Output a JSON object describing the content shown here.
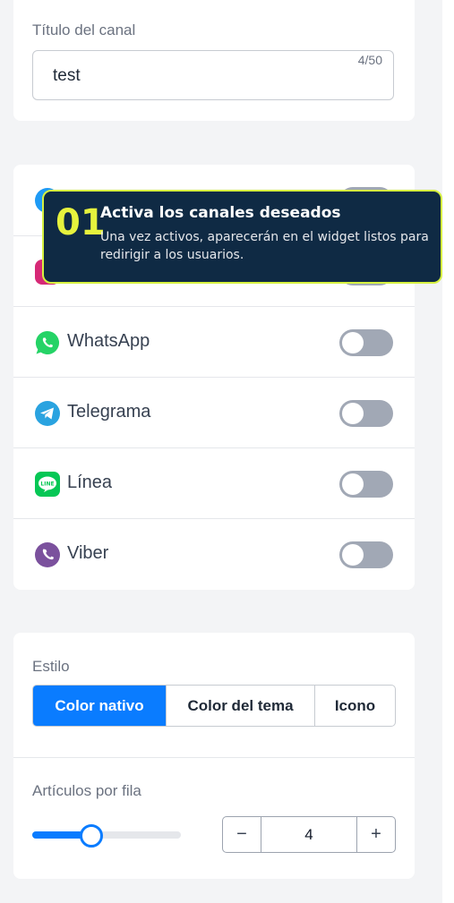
{
  "title_card": {
    "label": "Título del canal",
    "value": "test",
    "char_count": "4/50"
  },
  "channels": {
    "items": [
      {
        "name": "",
        "icon": "messenger-icon",
        "enabled": false,
        "color": "#1e9af5"
      },
      {
        "name": "",
        "icon": "instagram-icon",
        "enabled": false,
        "color": "#d62976"
      },
      {
        "name": "WhatsApp",
        "icon": "whatsapp-icon",
        "enabled": false,
        "color": "#25d366"
      },
      {
        "name": "Telegrama",
        "icon": "telegram-icon",
        "enabled": false,
        "color": "#2aa3e0"
      },
      {
        "name": "Línea",
        "icon": "line-icon",
        "enabled": false,
        "color": "#06c755"
      },
      {
        "name": "Viber",
        "icon": "viber-icon",
        "enabled": false,
        "color": "#7b519d"
      }
    ]
  },
  "tooltip": {
    "step": "01",
    "title": "Activa los canales deseados",
    "description": "Una vez activos, aparecerán en el widget listos para redirigir a los usuarios."
  },
  "style": {
    "label": "Estilo",
    "options": [
      "Color nativo",
      "Color del tema",
      "Icono"
    ],
    "selected": "Color nativo"
  },
  "items_per_row": {
    "label": "Artículos por fila",
    "value": "4",
    "slider_fraction": 0.4,
    "minus": "−",
    "plus": "+"
  },
  "colors": {
    "accent": "#0a7cff",
    "tooltip_bg": "#0f2a44",
    "tooltip_border": "#d6f140",
    "toggle_off": "#a1a8b5"
  }
}
